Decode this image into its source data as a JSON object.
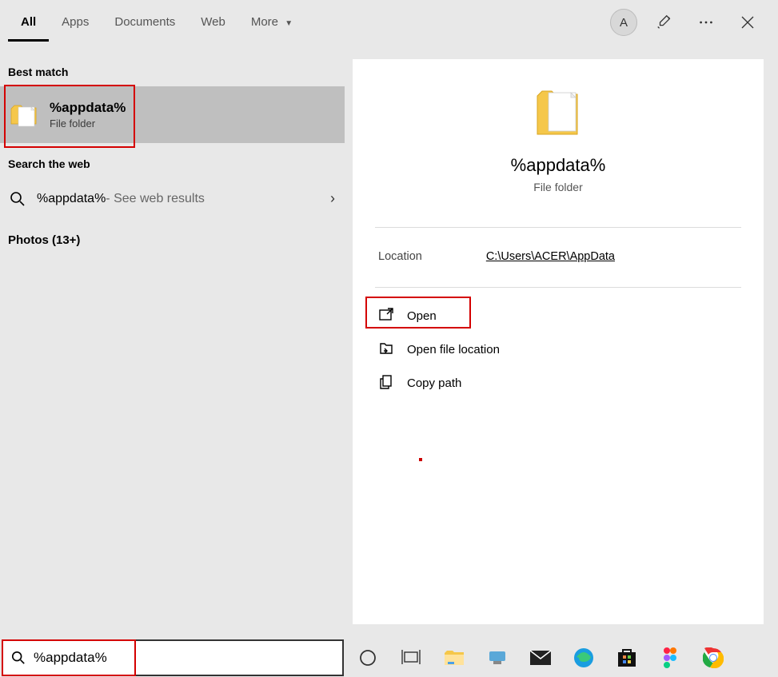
{
  "header": {
    "tabs": [
      {
        "label": "All",
        "active": true
      },
      {
        "label": "Apps"
      },
      {
        "label": "Documents"
      },
      {
        "label": "Web"
      },
      {
        "label": "More"
      }
    ],
    "avatar": "A"
  },
  "sections": {
    "best_match_label": "Best match",
    "search_web_label": "Search the web",
    "photos_label": "Photos (13+)"
  },
  "best_match": {
    "title": "%appdata%",
    "subtitle": "File folder"
  },
  "web_result": {
    "text": "%appdata%",
    "suffix": " - See web results"
  },
  "preview": {
    "title": "%appdata%",
    "subtitle": "File folder",
    "location_label": "Location",
    "location_path": "C:\\Users\\ACER\\AppData"
  },
  "actions": [
    {
      "label": "Open",
      "icon": "open"
    },
    {
      "label": "Open file location",
      "icon": "folder-location"
    },
    {
      "label": "Copy path",
      "icon": "copy"
    }
  ],
  "search": {
    "value": "%appdata%"
  }
}
